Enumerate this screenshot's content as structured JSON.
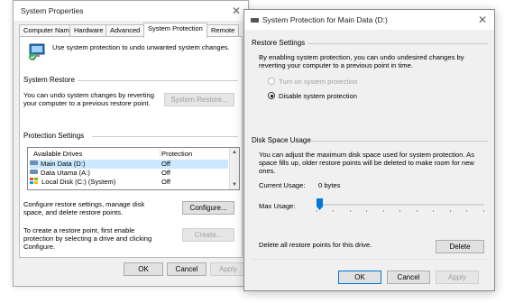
{
  "back_window": {
    "title": "System Properties",
    "tabs": [
      "Computer Name",
      "Hardware",
      "Advanced",
      "System Protection",
      "Remote"
    ],
    "active_tab": "System Protection",
    "intro_text": "Use system protection to undo unwanted system changes.",
    "system_restore": {
      "heading": "System Restore",
      "description": "You can undo system changes by reverting your computer to a previous restore point.",
      "button": "System Restore..."
    },
    "protection_settings": {
      "heading": "Protection Settings",
      "columns": [
        "Available Drives",
        "Protection"
      ],
      "rows": [
        {
          "drive": "Main Data (D:)",
          "protection": "Off"
        },
        {
          "drive": "Data Utama (A:)",
          "protection": "Off"
        },
        {
          "drive": "Local Disk (C:) (System)",
          "protection": "Off"
        }
      ],
      "configure_text": "Configure restore settings, manage disk space, and delete restore points.",
      "configure_button": "Configure...",
      "create_text": "To create a restore point, first enable protection by selecting a drive and clicking Configure.",
      "create_button": "Create..."
    },
    "buttons": {
      "ok": "OK",
      "cancel": "Cancel",
      "apply": "Apply"
    }
  },
  "front_window": {
    "title": "System Protection for Main Data (D:)",
    "restore_settings": {
      "heading": "Restore Settings",
      "description": "By enabling system protection, you can undo undesired changes by reverting your computer to a previous point in time.",
      "options": [
        {
          "label": "Turn on system protection",
          "selected": false,
          "enabled": false
        },
        {
          "label": "Disable system protection",
          "selected": true,
          "enabled": true
        }
      ]
    },
    "disk_space": {
      "heading": "Disk Space Usage",
      "description": "You can adjust the maximum disk space used for system protection. As space fills up, older restore points will be deleted to make room for new ones.",
      "current_usage_label": "Current Usage:",
      "current_usage_value": "0 bytes",
      "max_usage_label": "Max Usage:",
      "max_usage_fraction": 0.0
    },
    "delete_text": "Delete all restore points for this drive.",
    "delete_button": "Delete",
    "buttons": {
      "ok": "OK",
      "cancel": "Cancel",
      "apply": "Apply"
    }
  },
  "colors": {
    "accent": "#0078d7",
    "selected_row": "#cce8ff"
  }
}
